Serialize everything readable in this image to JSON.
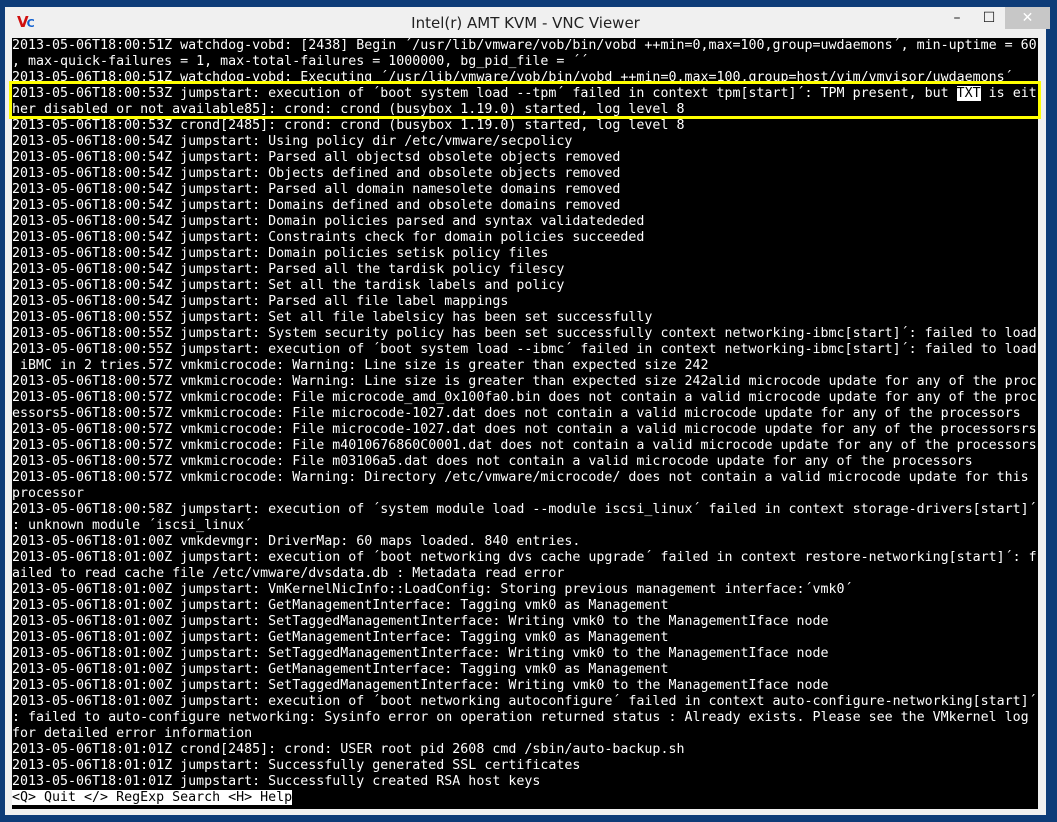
{
  "window": {
    "title": "Intel(r) AMT KVM - VNC Viewer",
    "logo": "VNC",
    "minimize": "–",
    "maximize": "☐",
    "close": "✕"
  },
  "terminal": {
    "lines_before": [
      "2013-05-06T18:00:51Z watchdog-vobd: [2438] Begin ´/usr/lib/vmware/vob/bin/vobd ++min=0,max=100,group=uwdaemons´, min-uptime = 60",
      ", max-quick-failures = 1, max-total-failures = 1000000, bg_pid_file = ´´",
      "2013-05-06T18:00:51Z watchdog-vobd: Executing ´/usr/lib/vmware/vob/bin/vobd ++min=0,max=100,group=host/vim/vmvisor/uwdaemons´"
    ],
    "highlight": {
      "pre": "2013-05-06T18:00:53Z jumpstart: execution of ´boot system load --tpm´ failed in context tpm[start]´: TPM present, but ",
      "inverse": "TXT",
      "post": " is eit",
      "line2": "her disabled or not available85]: crond: crond (busybox 1.19.0) started, log level 8"
    },
    "lines_after": [
      "2013-05-06T18:00:53Z crond[2485]: crond: crond (busybox 1.19.0) started, log level 8",
      "2013-05-06T18:00:54Z jumpstart: Using policy dir /etc/vmware/secpolicy",
      "2013-05-06T18:00:54Z jumpstart: Parsed all objectsd obsolete objects removed",
      "2013-05-06T18:00:54Z jumpstart: Objects defined and obsolete objects removed",
      "2013-05-06T18:00:54Z jumpstart: Parsed all domain namesolete domains removed",
      "2013-05-06T18:00:54Z jumpstart: Domains defined and obsolete domains removed",
      "2013-05-06T18:00:54Z jumpstart: Domain policies parsed and syntax validatededed",
      "2013-05-06T18:00:54Z jumpstart: Constraints check for domain policies succeeded",
      "2013-05-06T18:00:54Z jumpstart: Domain policies setisk policy files",
      "2013-05-06T18:00:54Z jumpstart: Parsed all the tardisk policy filescy",
      "2013-05-06T18:00:54Z jumpstart: Set all the tardisk labels and policy",
      "2013-05-06T18:00:54Z jumpstart: Parsed all file label mappings",
      "2013-05-06T18:00:55Z jumpstart: Set all file labelsicy has been set successfully",
      "2013-05-06T18:00:55Z jumpstart: System security policy has been set successfully context networking-ibmc[start]´: failed to load",
      "2013-05-06T18:00:55Z jumpstart: execution of ´boot system load --ibmc´ failed in context networking-ibmc[start]´: failed to load",
      " iBMC in 2 tries.57Z vmkmicrocode: Warning: Line size is greater than expected size 242",
      "2013-05-06T18:00:57Z vmkmicrocode: Warning: Line size is greater than expected size 242alid microcode update for any of the proc",
      "2013-05-06T18:00:57Z vmkmicrocode: File microcode_amd_0x100fa0.bin does not contain a valid microcode update for any of the proc",
      "essors5-06T18:00:57Z vmkmicrocode: File microcode-1027.dat does not contain a valid microcode update for any of the processors",
      "2013-05-06T18:00:57Z vmkmicrocode: File microcode-1027.dat does not contain a valid microcode update for any of the processorsrs",
      "2013-05-06T18:00:57Z vmkmicrocode: File m4010676860C0001.dat does not contain a valid microcode update for any of the processors",
      "2013-05-06T18:00:57Z vmkmicrocode: File m03106a5.dat does not contain a valid microcode update for any of the processors",
      "2013-05-06T18:00:57Z vmkmicrocode: Warning: Directory /etc/vmware/microcode/ does not contain a valid microcode update for this",
      "processor",
      "2013-05-06T18:00:58Z jumpstart: execution of ´system module load --module iscsi_linux´ failed in context storage-drivers[start]´",
      ": unknown module ´iscsi_linux´",
      "2013-05-06T18:01:00Z vmkdevmgr: DriverMap: 60 maps loaded. 840 entries.",
      "2013-05-06T18:01:00Z jumpstart: execution of ´boot networking dvs cache upgrade´ failed in context restore-networking[start]´: f",
      "ailed to read cache file /etc/vmware/dvsdata.db : Metadata read error",
      "2013-05-06T18:01:00Z jumpstart: VmKernelNicInfo::LoadConfig: Storing previous management interface:´vmk0´",
      "2013-05-06T18:01:00Z jumpstart: GetManagementInterface: Tagging vmk0 as Management",
      "2013-05-06T18:01:00Z jumpstart: SetTaggedManagementInterface: Writing vmk0 to the ManagementIface node",
      "2013-05-06T18:01:00Z jumpstart: GetManagementInterface: Tagging vmk0 as Management",
      "2013-05-06T18:01:00Z jumpstart: SetTaggedManagementInterface: Writing vmk0 to the ManagementIface node",
      "2013-05-06T18:01:00Z jumpstart: GetManagementInterface: Tagging vmk0 as Management",
      "2013-05-06T18:01:00Z jumpstart: SetTaggedManagementInterface: Writing vmk0 to the ManagementIface node",
      "2013-05-06T18:01:00Z jumpstart: execution of ´boot networking autoconfigure´ failed in context auto-configure-networking[start]´",
      ": failed to auto-configure networking: Sysinfo error on operation returned status : Already exists. Please see the VMkernel log",
      "for detailed error information",
      "2013-05-06T18:01:01Z crond[2485]: crond: USER root pid 2608 cmd /sbin/auto-backup.sh",
      "2013-05-06T18:01:01Z jumpstart: Successfully generated SSL certificates",
      "2013-05-06T18:01:01Z jumpstart: Successfully created RSA host keys"
    ],
    "status_bar": "<Q> Quit </> RegExp Search <H> Help"
  },
  "colors": {
    "highlight_box": "#ffff00",
    "desktop": "#0e3c78"
  }
}
